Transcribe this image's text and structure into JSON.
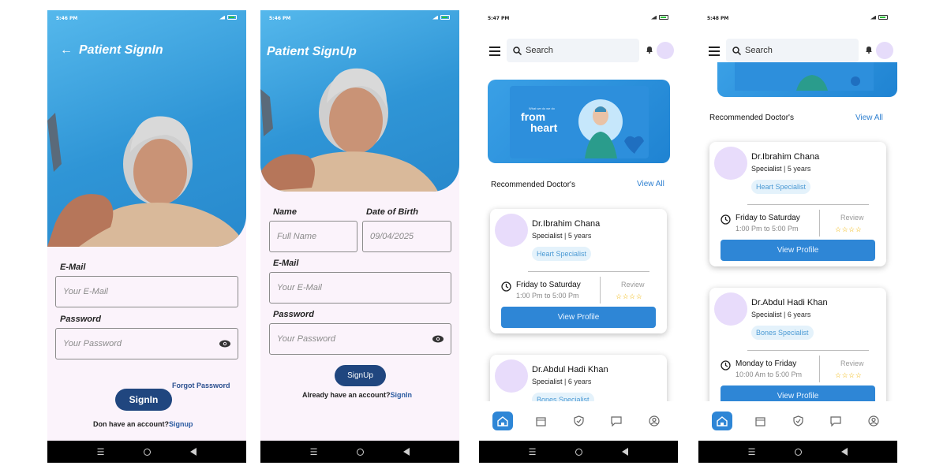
{
  "signin": {
    "status_time": "5:46 PM",
    "title": "Patient SignIn",
    "email_label": "E-Mail",
    "email_placeholder": "Your E-Mail",
    "password_label": "Password",
    "password_placeholder": "Your Password",
    "forgot_label": "Forgot Password",
    "signin_label": "SignIn",
    "prompt": "Don  have an account?",
    "signup_link": "Signup"
  },
  "signup": {
    "status_time": "5:46 PM",
    "title": "Patient SignUp",
    "name_label": "Name",
    "name_placeholder": "Full Name",
    "dob_label": "Date of Birth",
    "dob_placeholder": "09/04/2025",
    "email_label": "E-Mail",
    "email_placeholder": "Your E-Mail",
    "password_label": "Password",
    "password_placeholder": "Your Password",
    "signup_label": "SignUp",
    "prompt": "Already have an account?",
    "signin_link": "SignIn"
  },
  "home": {
    "status_time_1": "5:47 PM",
    "status_time_2": "5:48 PM",
    "search_placeholder": "Search",
    "banner": {
      "from": "from",
      "heart": "heart",
      "tagline": "What we do we do"
    },
    "section_title": "Recommended Doctor's",
    "view_all": "View All",
    "review_label": "Review",
    "view_profile": "View Profile",
    "doctors": [
      {
        "name": "Dr.Ibrahim Chana",
        "role": "Specialist",
        "years": "5 years",
        "tag": "Heart Specialist",
        "days": "Friday  to Saturday",
        "hours": "1:00 Pm to 5:00 Pm",
        "stars": "☆☆☆☆"
      },
      {
        "name": "Dr.Abdul Hadi Khan",
        "role": "Specialist",
        "years": "6 years",
        "tag": "Bones Specialist",
        "days": "Monday to Friday",
        "hours": "10:00 Am  to 5:00 Pm",
        "stars": "☆☆☆☆"
      }
    ],
    "nav_items": [
      "home-icon",
      "calendar-icon",
      "shield-check-icon",
      "chat-icon",
      "profile-icon"
    ]
  }
}
